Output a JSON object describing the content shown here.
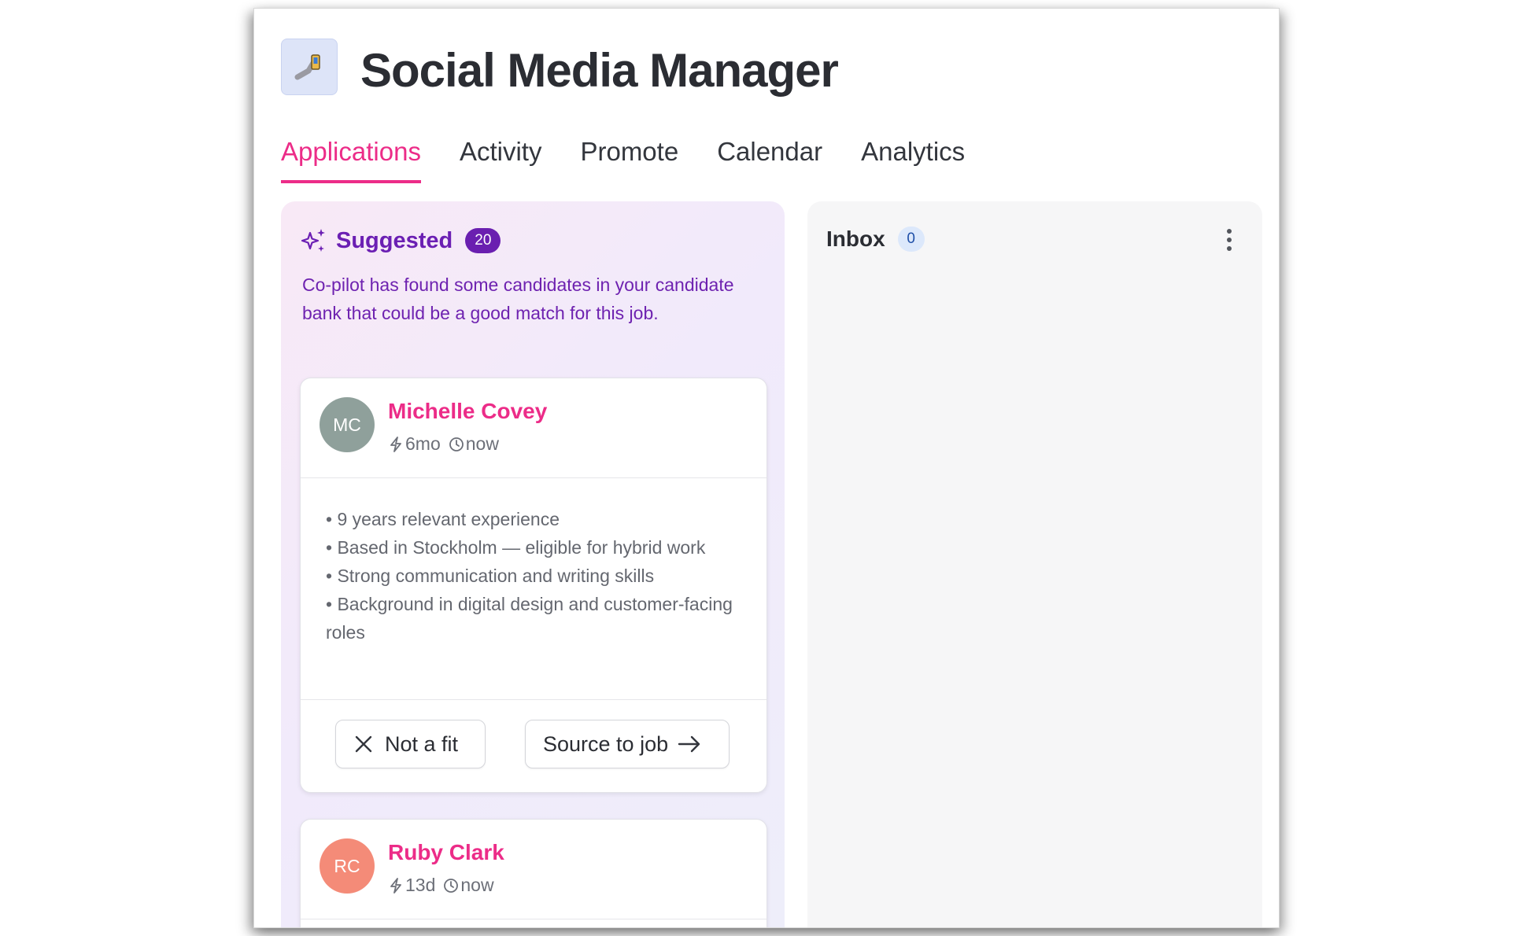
{
  "app": {
    "title": "Social Media Manager",
    "icon": "phone-icon"
  },
  "tabs": [
    {
      "label": "Applications",
      "active": true
    },
    {
      "label": "Activity",
      "active": false
    },
    {
      "label": "Promote",
      "active": false
    },
    {
      "label": "Calendar",
      "active": false
    },
    {
      "label": "Analytics",
      "active": false
    }
  ],
  "suggested": {
    "title": "Suggested",
    "count": "20",
    "description": "Co-pilot has found some candidates in your candidate bank that could be a good match for this job.",
    "candidates": [
      {
        "initials": "MC",
        "name": "Michelle Covey",
        "activity": "6mo",
        "time": "now",
        "avatar_color": "#8fa09b",
        "highlights": [
          "• 9 years relevant experience",
          "• Based in Stockholm — eligible for hybrid work",
          "• Strong communication and writing skills",
          "• Background in digital design and customer-facing roles"
        ],
        "actions": {
          "reject_label": "Not a fit",
          "source_label": "Source to job"
        }
      },
      {
        "initials": "RC",
        "name": "Ruby Clark",
        "activity": "13d",
        "time": "now",
        "avatar_color": "#f48b78"
      }
    ]
  },
  "inbox": {
    "title": "Inbox",
    "count": "0"
  },
  "colors": {
    "accent": "#ec2c88",
    "purple": "#6a1fb0"
  }
}
